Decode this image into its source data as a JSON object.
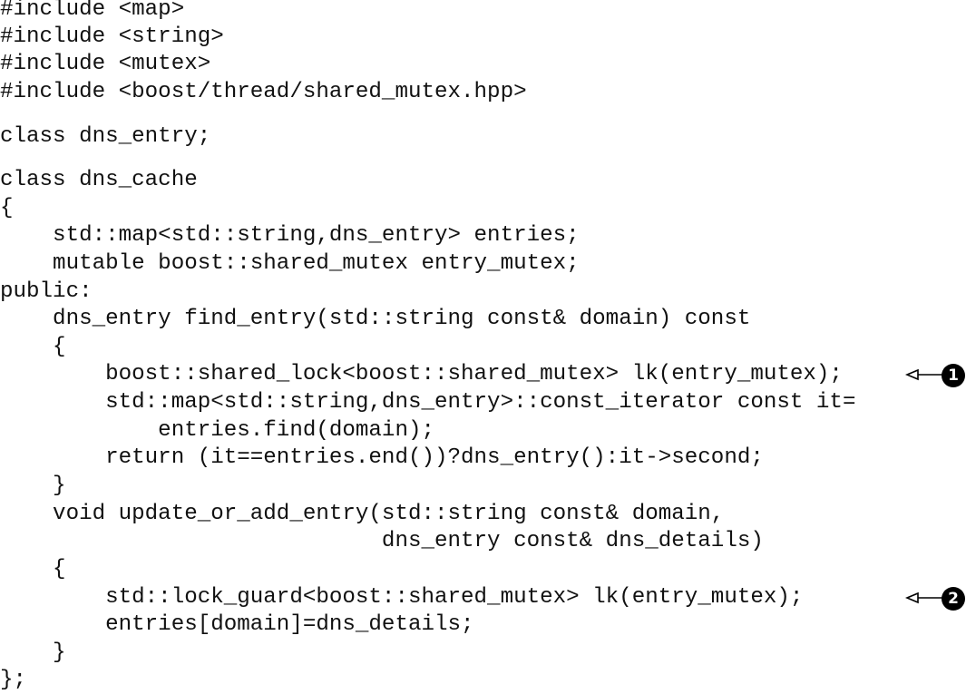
{
  "code": {
    "lines": [
      "#include <map>",
      "#include <string>",
      "#include <mutex>",
      "#include <boost/thread/shared_mutex.hpp>",
      "class dns_entry;",
      "class dns_cache",
      "{",
      "    std::map<std::string,dns_entry> entries;",
      "    mutable boost::shared_mutex entry_mutex;",
      "public:",
      "    dns_entry find_entry(std::string const& domain) const",
      "    {",
      "        boost::shared_lock<boost::shared_mutex> lk(entry_mutex);",
      "        std::map<std::string,dns_entry>::const_iterator const it=",
      "            entries.find(domain);",
      "        return (it==entries.end())?dns_entry():it->second;",
      "    }",
      "    void update_or_add_entry(std::string const& domain,",
      "                             dns_entry const& dns_details)",
      "    {",
      "        std::lock_guard<boost::shared_mutex> lk(entry_mutex);",
      "        entries[domain]=dns_details;",
      "    }",
      "};"
    ]
  },
  "callouts": [
    {
      "number": "1"
    },
    {
      "number": "2"
    }
  ]
}
